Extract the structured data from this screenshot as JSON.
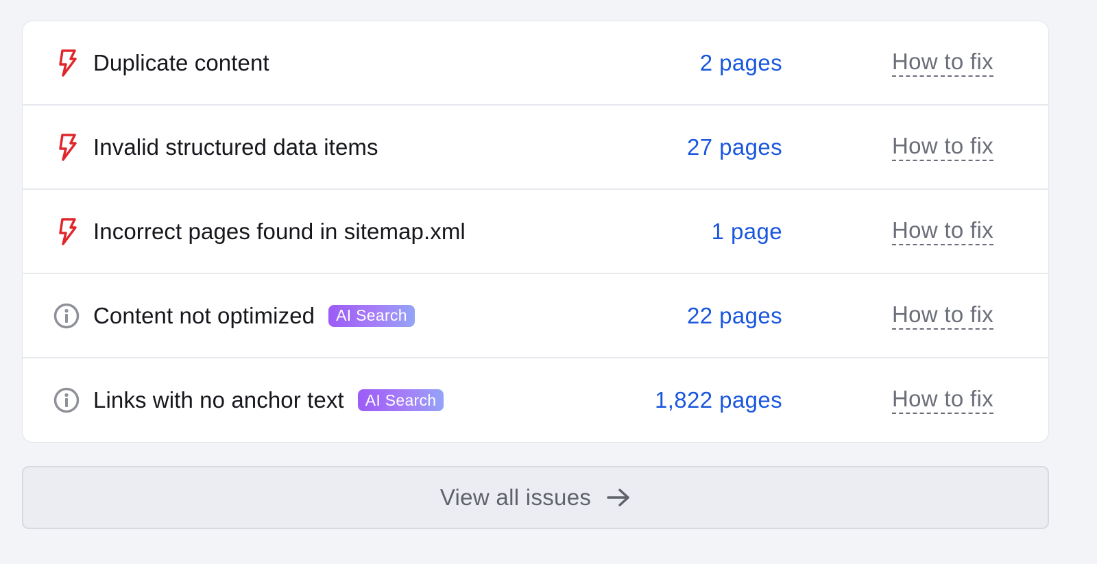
{
  "issues": [
    {
      "icon": "lightning-icon",
      "title": "Duplicate content",
      "badge": "",
      "pages": "2 pages",
      "fix": "How to fix"
    },
    {
      "icon": "lightning-icon",
      "title": "Invalid structured data items",
      "badge": "",
      "pages": "27 pages",
      "fix": "How to fix"
    },
    {
      "icon": "lightning-icon",
      "title": "Incorrect pages found in sitemap.xml",
      "badge": "",
      "pages": "1 page",
      "fix": "How to fix"
    },
    {
      "icon": "info-icon",
      "title": "Content not optimized",
      "badge": "AI Search",
      "pages": "22 pages",
      "fix": "How to fix"
    },
    {
      "icon": "info-icon",
      "title": "Links with no anchor text",
      "badge": "AI Search",
      "pages": "1,822 pages",
      "fix": "How to fix"
    }
  ],
  "footer": {
    "view_all_label": "View all issues",
    "arrow_icon": "arrow-right-icon"
  },
  "colors": {
    "error": "#e0262b",
    "info": "#8f9198",
    "link": "#1a57dd",
    "badge_gradient_start": "#9b5cf6",
    "badge_gradient_end": "#93a4f7"
  }
}
